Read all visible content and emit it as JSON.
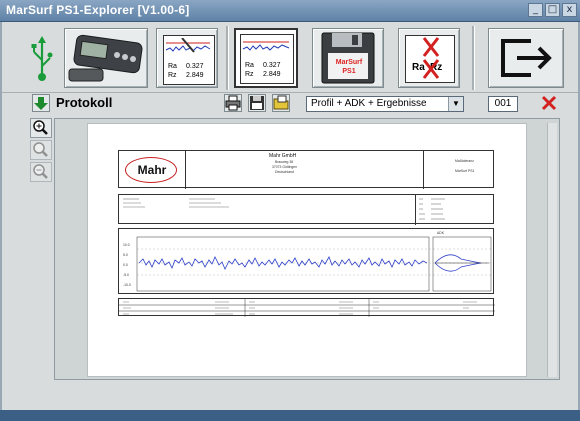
{
  "window": {
    "title": "MarSurf PS1-Explorer [V1.00-6]",
    "controls": [
      "_",
      "□",
      "x"
    ]
  },
  "toolbar": {
    "usb_icon": "usb-icon",
    "device_icon": "device-icon",
    "measurement_readout": {
      "ra_label": "Ra",
      "ra_value": "0.327",
      "rz_label": "Rz",
      "rz_value": "2.849"
    },
    "protocol_readout": {
      "ra_label": "Ra",
      "ra_value": "0.327",
      "rz_label": "Rz",
      "rz_value": "2.849"
    },
    "floppy_label_top": "MarSurf",
    "floppy_label_bottom": "PS1",
    "delete_ra": "Ra",
    "delete_rz": "Rz",
    "exit_icon": "exit-icon"
  },
  "bar2": {
    "download_icon": "arrow-down-icon",
    "label": "Protokoll",
    "print_icon": "printer-icon",
    "save_icon": "floppy-icon",
    "load_icon": "folder-icon",
    "select_value": "Profil + ADK + Ergebnisse",
    "page_number": "001",
    "close_icon": "close-x-icon"
  },
  "zoom": {
    "zoom_in": "zoom-in-icon",
    "zoom_fit": "zoom-fit-icon",
    "zoom_out": "zoom-out-icon"
  },
  "report": {
    "logo": "Mahr",
    "company": "Mahr GmbH",
    "company_lines": [
      "Brauweg 38",
      "37073 Göttingen",
      "Deutschland"
    ],
    "right_header_1": "Maßtoleranz",
    "right_header_2": "MarSurf PS1",
    "axis_values": [
      "10.0",
      "5.0",
      "0.0",
      "-5.0",
      "-10.0"
    ],
    "profile_label": "ADK"
  },
  "colors": {
    "titlebar": "#5f82a6",
    "panel": "#d8dcdc",
    "profile_line": "#2d3fc9",
    "red_x": "#d32020"
  }
}
